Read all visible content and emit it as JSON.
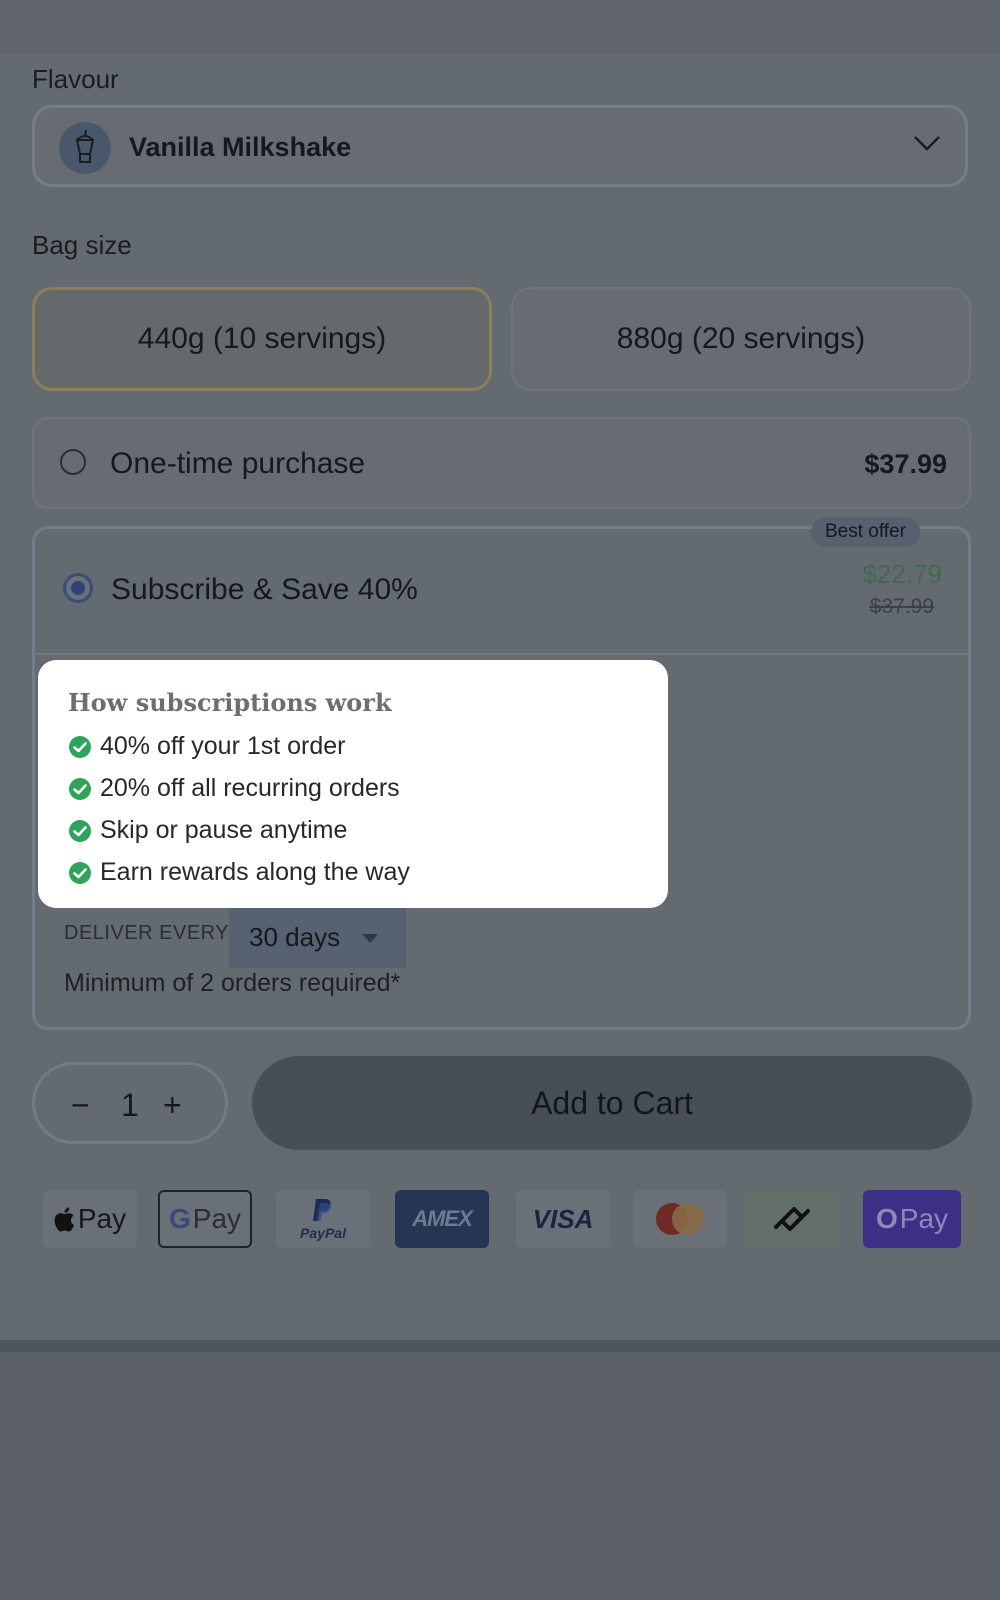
{
  "flavour": {
    "label": "Flavour",
    "selected": "Vanilla Milkshake",
    "icon": "milkshake-icon"
  },
  "bag_size": {
    "label": "Bag size",
    "options": [
      "440g (10 servings)",
      "880g (20 servings)"
    ],
    "selected": "440g (10 servings)"
  },
  "one_time": {
    "title": "One-time purchase",
    "price": "$37.99"
  },
  "subscribe": {
    "title": "Subscribe & Save 40%",
    "badge": "Best offer",
    "price": "$22.79",
    "old_price": "$37.99",
    "deliver_label": "DELIVER EVERY",
    "deliver_value": "30 days",
    "minimum_note": "Minimum of 2 orders required*"
  },
  "tooltip": {
    "heading": "How subscriptions work",
    "items": [
      "40% off your 1st order",
      "20% off all recurring orders",
      "Skip or pause anytime",
      "Earn rewards along the way"
    ]
  },
  "cart": {
    "minus": "−",
    "quantity": "1",
    "plus": "+",
    "add_label": "Add to Cart"
  },
  "payment_methods": [
    {
      "name": "apple-pay",
      "label": "Pay"
    },
    {
      "name": "google-pay",
      "label": "Pay"
    },
    {
      "name": "paypal",
      "label": "PayPal"
    },
    {
      "name": "amex",
      "label": "AMEX"
    },
    {
      "name": "visa",
      "label": "VISA"
    },
    {
      "name": "mastercard",
      "label": ""
    },
    {
      "name": "afterpay",
      "label": ""
    },
    {
      "name": "shop-pay",
      "label": "Pay"
    }
  ],
  "colors": {
    "overlay": "#5b6167",
    "check_green": "#2ea35a",
    "shop_pay": "#3b2f86"
  }
}
